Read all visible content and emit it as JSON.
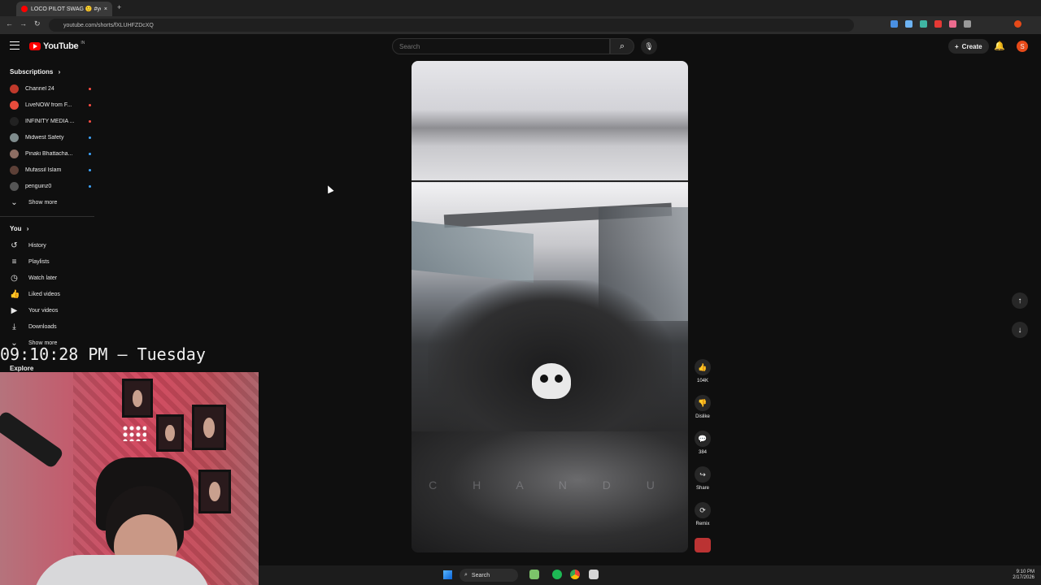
{
  "browser": {
    "tab_title": "LOCO PILOT SWAG 🙂 #yo",
    "url": "youtube.com/shorts/fXLUHFZDcXQ",
    "nav_back": "←",
    "nav_forward": "→",
    "nav_reload": "↻",
    "add_tab": "+",
    "tab_close": "×"
  },
  "masthead": {
    "logo_text": "YouTube",
    "country_code": "IN",
    "search_placeholder": "Search",
    "search_icon": "⌕",
    "mic_icon": "🎙",
    "create_label": "Create",
    "create_icon": "+",
    "bell_icon": "🔔",
    "avatar_letter": "S"
  },
  "sidebar": {
    "subscriptions_heading": "Subscriptions",
    "subscriptions_chevron": "›",
    "subscriptions": [
      {
        "name": "Channel 24",
        "status": "live",
        "color": "#c0392b"
      },
      {
        "name": "LiveNOW from F...",
        "status": "live",
        "color": "#e74c3c"
      },
      {
        "name": "INFINITY MEDIA ...",
        "status": "live",
        "color": "#222222"
      },
      {
        "name": "Midwest Safety",
        "status": "new",
        "color": "#7f8c8d"
      },
      {
        "name": "Pinaki Bhattacha...",
        "status": "new",
        "color": "#8d6e63"
      },
      {
        "name": "Mufassil Islam",
        "status": "new",
        "color": "#5d4037"
      },
      {
        "name": "penguinz0",
        "status": "new",
        "color": "#555555"
      }
    ],
    "subs_show_more": "Show more",
    "you_heading": "You",
    "you_chevron": "›",
    "you_items": [
      {
        "label": "History",
        "icon": "↺"
      },
      {
        "label": "Playlists",
        "icon": "≡"
      },
      {
        "label": "Watch later",
        "icon": "◷"
      },
      {
        "label": "Liked videos",
        "icon": "👍"
      },
      {
        "label": "Your videos",
        "icon": "▶"
      },
      {
        "label": "Downloads",
        "icon": "⤓"
      }
    ],
    "you_show_more": "Show more",
    "chevron_down": "⌄",
    "explore_heading": "Explore"
  },
  "short": {
    "watermark_text": "C H A N D U"
  },
  "actions": {
    "like_count": "104K",
    "dislike_label": "Dislike",
    "comment_count": "384",
    "share_label": "Share",
    "remix_label": "Remix",
    "like_icon": "👍",
    "dislike_icon": "👎",
    "comment_icon": "💬",
    "share_icon": "↪",
    "remix_icon": "⟳"
  },
  "shorts_nav": {
    "up_icon": "↑",
    "down_icon": "↓"
  },
  "overlay": {
    "clock_text": "09:10:28 PM – Tuesday"
  },
  "taskbar": {
    "search_label": "Search",
    "search_icon": "⌕",
    "time": "9:10 PM",
    "date": "2/17/2026"
  }
}
